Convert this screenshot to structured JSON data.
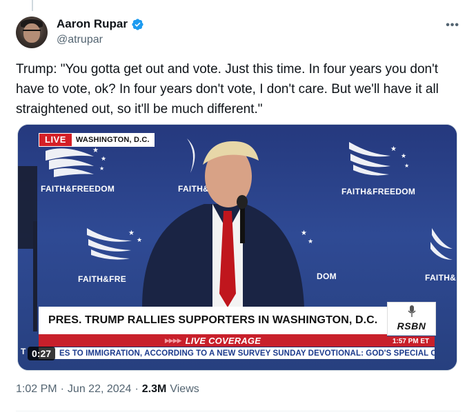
{
  "tweet": {
    "author": {
      "display_name": "Aaron Rupar",
      "handle": "@atrupar",
      "verified": true
    },
    "text": "Trump: \"You gotta get out and vote. Just this time. In four years you don't have to vote, ok? In four years don't vote, I don't care. But we'll have it all straightened out, so it'll be much different.\"",
    "more_icon": "more-horizontal-icon",
    "meta": {
      "time": "1:02 PM",
      "separator1": "·",
      "date": "Jun 22, 2024",
      "separator2": "·",
      "views_count": "2.3M",
      "views_label": "Views"
    }
  },
  "video": {
    "duration": "0:27",
    "live_label": "LIVE",
    "location": "WASHINGTON, D.C.",
    "logo_text": "FAITH&FREEDOM",
    "logo_partial_1": "FAITH&",
    "logo_partial_2": "FAITH&FRE",
    "logo_partial_3": "DOM",
    "logo_partial_4": "FAITH&",
    "headline": "PRES. TRUMP RALLIES SUPPORTERS IN WASHINGTON, D.C.",
    "coverage": "LIVE COVERAGE",
    "ticker": "ES TO IMMIGRATION, ACCORDING TO A NEW SURVEY    SUNDAY DEVOTIONAL: GOD'S SPECIAL C",
    "ticker_lead": "T",
    "network": "RSBN",
    "timestamp": "1:57 PM ET"
  },
  "colors": {
    "verified_blue": "#1d9bf0",
    "live_red": "#d41f26",
    "stage_blue": "#2a3f86",
    "muted_text": "#536471"
  }
}
